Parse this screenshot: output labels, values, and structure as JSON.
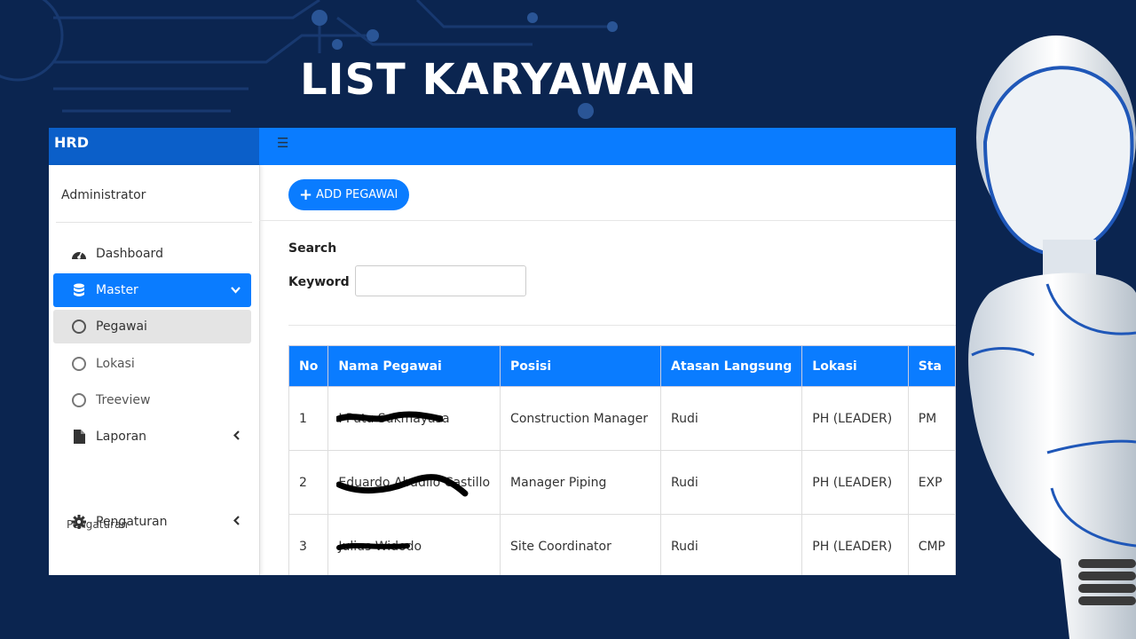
{
  "banner": {
    "title": "LIST KARYAWAN"
  },
  "app": {
    "brand": "HRD",
    "topbar": {
      "menu_icon": "hamburger-icon"
    }
  },
  "sidebar": {
    "user": "Administrator",
    "items": [
      {
        "label": "Dashboard",
        "icon": "dashboard-icon"
      },
      {
        "label": "Master",
        "icon": "database-icon",
        "chevron": "down"
      },
      {
        "label": "Pegawai",
        "icon": "circle-icon"
      },
      {
        "label": "Lokasi",
        "icon": "circle-icon"
      },
      {
        "label": "Treeview",
        "icon": "circle-icon"
      },
      {
        "label": "Laporan",
        "icon": "file-icon",
        "chevron": "left"
      }
    ],
    "section_label": "Pengaturan",
    "settings": {
      "label": "Pengaturan",
      "icon": "gear-icon",
      "chevron": "left"
    }
  },
  "content": {
    "add_button": "ADD PEGAWAI",
    "search_title": "Search",
    "keyword_label": "Keyword :",
    "keyword_value": ""
  },
  "table": {
    "headers": [
      "No",
      "Nama Pegawai",
      "Posisi",
      "Atasan Langsung",
      "Lokasi",
      "Sta"
    ],
    "rows": [
      {
        "no": "1",
        "nama": "I Putu Sukmayasa",
        "posisi": "Construction Manager",
        "atasan": "Rudi",
        "lokasi": "PH (LEADER)",
        "status": "PM"
      },
      {
        "no": "2",
        "nama": "Eduardo Abadilo Castillo",
        "posisi": "Manager Piping",
        "atasan": "Rudi",
        "lokasi": "PH (LEADER)",
        "status": "EXP"
      },
      {
        "no": "3",
        "nama": "Julius Widodo",
        "posisi": "Site Coordinator",
        "atasan": "Rudi",
        "lokasi": "PH (LEADER)",
        "status": "CMP"
      }
    ]
  },
  "colors": {
    "primary": "#0a7cff",
    "brand": "#0b5fc9",
    "background": "#0b2550"
  }
}
